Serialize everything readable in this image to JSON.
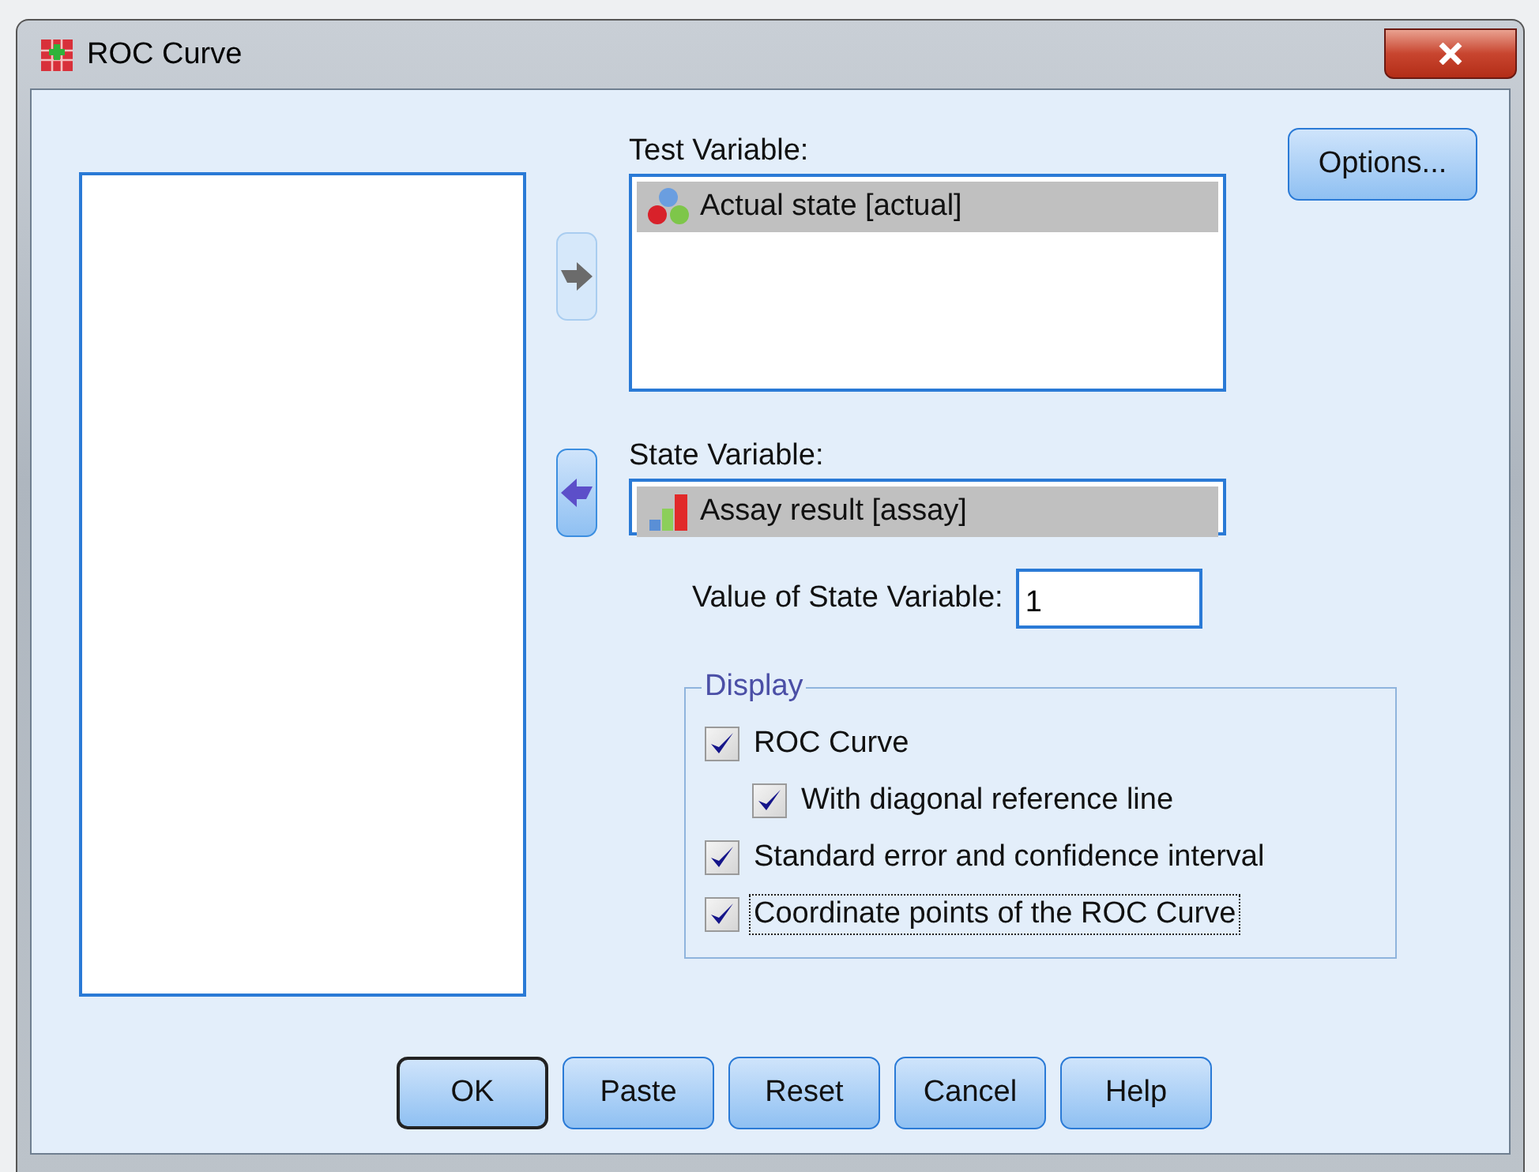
{
  "window": {
    "title": "ROC Curve"
  },
  "test_variable": {
    "label": "Test Variable:",
    "move_button": {
      "disabled": true
    },
    "items": [
      {
        "text": "Actual state [actual]",
        "kind": "nominal",
        "selected": true
      }
    ]
  },
  "state_variable": {
    "label": "State Variable:",
    "move_button": {
      "disabled": false
    },
    "items": [
      {
        "text": "Assay result [assay]",
        "kind": "scale",
        "selected": true
      }
    ]
  },
  "state_value": {
    "label": "Value of State Variable:",
    "value": "1"
  },
  "options_button": {
    "label": "Options..."
  },
  "display": {
    "title": "Display",
    "options": [
      {
        "label": "ROC Curve",
        "checked": true,
        "focused": false,
        "children": [
          {
            "label": "With diagonal reference line",
            "checked": true,
            "focused": false
          }
        ]
      },
      {
        "label": "Standard error and confidence interval",
        "checked": true,
        "focused": false
      },
      {
        "label": "Coordinate points of the ROC Curve",
        "checked": true,
        "focused": true
      }
    ]
  },
  "buttons": [
    {
      "label": "OK",
      "default": true
    },
    {
      "label": "Paste",
      "default": false
    },
    {
      "label": "Reset",
      "default": false
    },
    {
      "label": "Cancel",
      "default": false
    },
    {
      "label": "Help",
      "default": false
    }
  ]
}
